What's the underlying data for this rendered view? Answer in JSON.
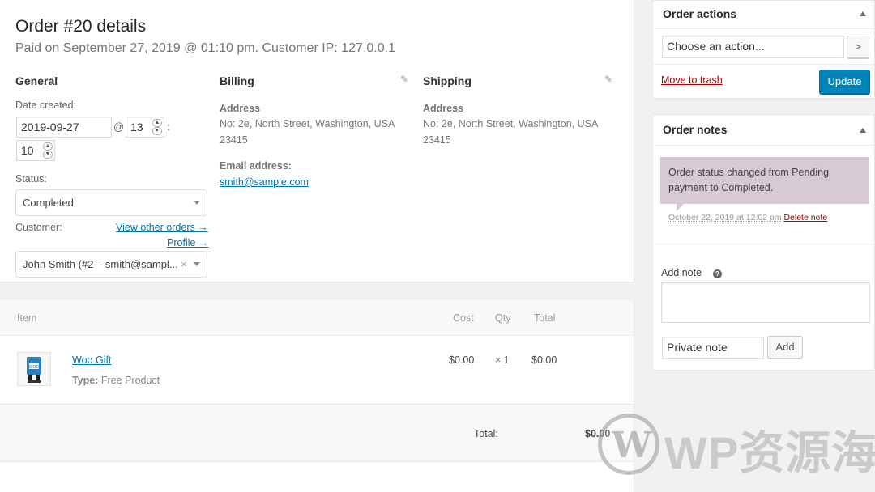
{
  "order": {
    "title": "Order #20 details",
    "subtitle": "Paid on September 27, 2019 @ 01:10 pm. Customer IP: 127.0.0.1"
  },
  "general": {
    "heading": "General",
    "date_label": "Date created:",
    "date_value": "2019-09-27",
    "at_sep": "@",
    "hour_value": "13",
    "colon_sep": ":",
    "minute_value": "10",
    "status_label": "Status:",
    "status_value": "Completed",
    "customer_label": "Customer:",
    "view_orders_link": "View other orders →",
    "profile_link": "Profile →",
    "customer_value": "John Smith (#2 – smith@sampl...",
    "clear_symbol": "×"
  },
  "billing": {
    "heading": "Billing",
    "address_label": "Address",
    "address_line1": "No: 2e, North Street, Washington, USA",
    "address_line2": "23415",
    "email_label": "Email address:",
    "email_value": "smith@sample.com"
  },
  "shipping": {
    "heading": "Shipping",
    "address_label": "Address",
    "address_line1": "No: 2e, North Street, Washington, USA",
    "address_line2": "23415"
  },
  "items": {
    "columns": {
      "item": "Item",
      "cost": "Cost",
      "qty": "Qty",
      "total": "Total"
    },
    "rows": [
      {
        "name": "Woo Gift",
        "type_label": "Type:",
        "type_value": "Free Product",
        "cost": "$0.00",
        "qty": "× 1",
        "total": "$0.00"
      }
    ],
    "total_label": "Total:",
    "total_value": "$0.00"
  },
  "order_actions": {
    "title": "Order actions",
    "select_placeholder": "Choose an action...",
    "go_label": ">",
    "trash_link": "Move to trash",
    "update_label": "Update"
  },
  "order_notes": {
    "title": "Order notes",
    "note_text": "Order status changed from Pending payment to Completed.",
    "note_date": "October 22, 2019 at 12:02 pm",
    "delete_link": "Delete note",
    "add_note_label": "Add note",
    "help_symbol": "?",
    "note_type_value": "Private note",
    "add_label": "Add"
  },
  "watermark": {
    "logo_letter": "W",
    "text": "WP资源海"
  }
}
